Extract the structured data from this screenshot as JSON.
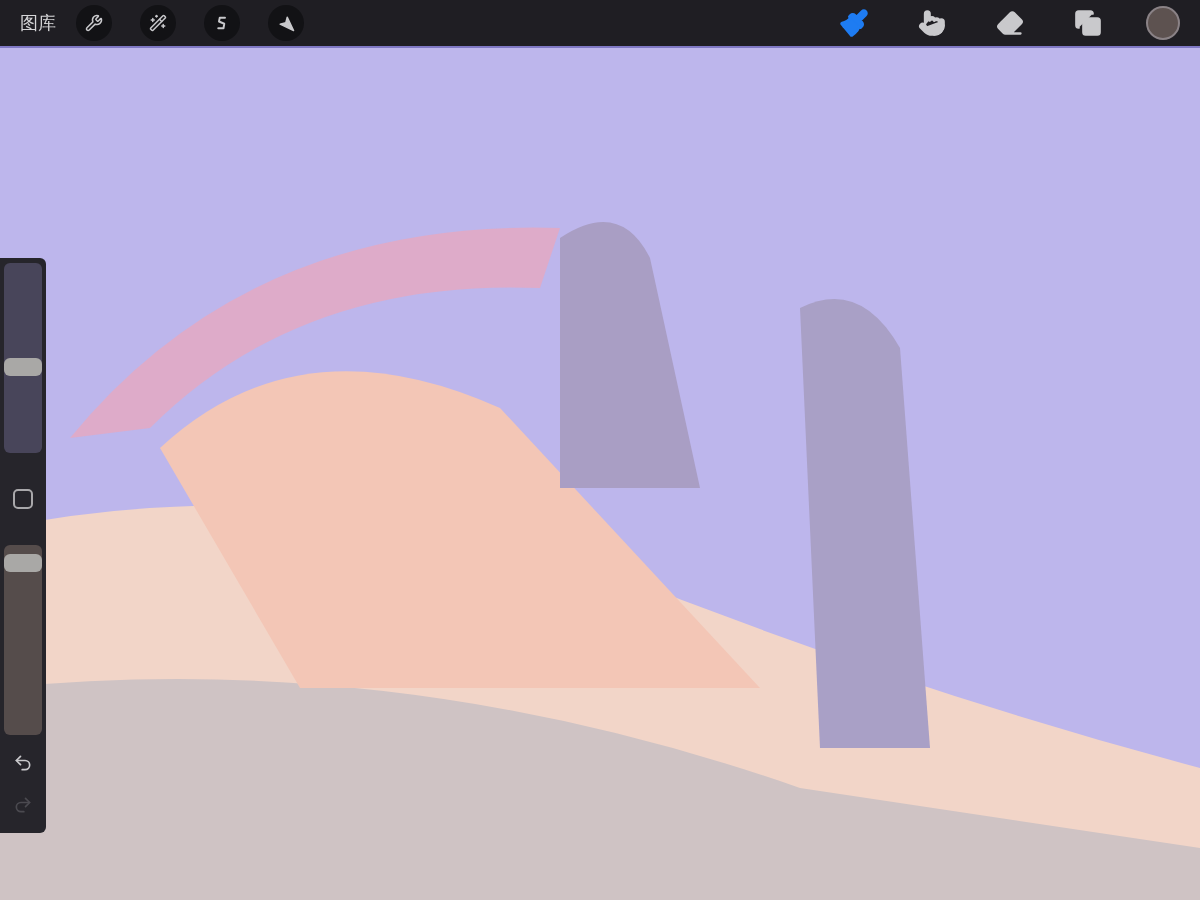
{
  "toolbar": {
    "gallery_label": "图库",
    "left_tools": [
      {
        "kind": "wrench",
        "selected": false
      },
      {
        "kind": "wand",
        "selected": false
      },
      {
        "kind": "selection",
        "selected": false
      },
      {
        "kind": "move",
        "selected": false
      }
    ],
    "right_tools": [
      {
        "kind": "brush",
        "selected": true
      },
      {
        "kind": "smudge",
        "selected": false
      },
      {
        "kind": "eraser",
        "selected": false
      },
      {
        "kind": "layers",
        "selected": false
      }
    ],
    "color_swatch": {
      "color": "#5d5250"
    }
  },
  "sidebar": {
    "brush_size": {
      "level": 0.45
    },
    "opacity": {
      "level": 0.95
    },
    "undo": {
      "disabled": false
    },
    "redo": {
      "disabled": true
    }
  }
}
